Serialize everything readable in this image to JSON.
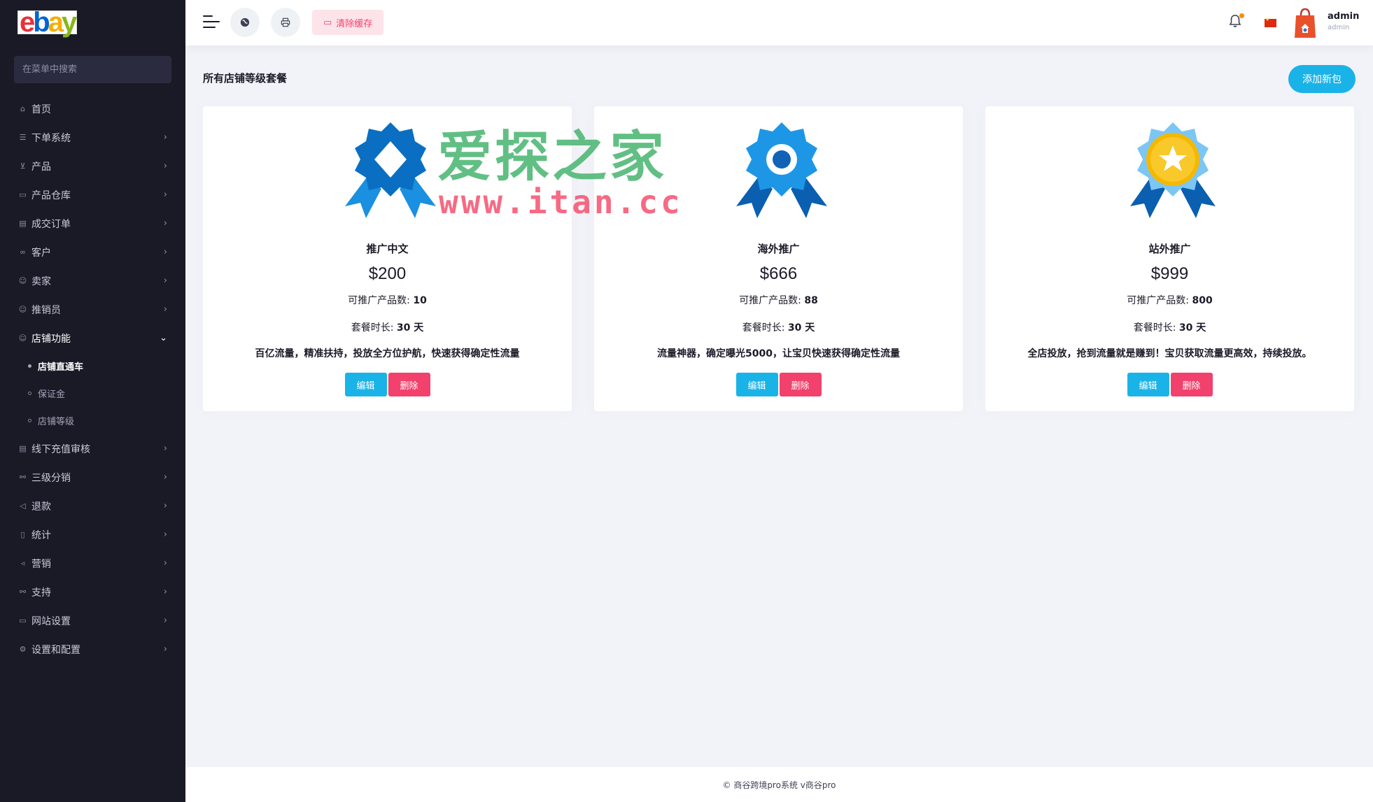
{
  "brand": {
    "logo_text": "ebay"
  },
  "sidebar": {
    "search_placeholder": "在菜单中搜索",
    "items": [
      {
        "label": "首页",
        "icon": "home-icon",
        "has_children": false
      },
      {
        "label": "下单系统",
        "icon": "list-icon",
        "has_children": true
      },
      {
        "label": "产品",
        "icon": "cart-icon",
        "has_children": true
      },
      {
        "label": "产品仓库",
        "icon": "archive-icon",
        "has_children": true
      },
      {
        "label": "成交订单",
        "icon": "money-icon",
        "has_children": true
      },
      {
        "label": "客户",
        "icon": "users-icon",
        "has_children": true
      },
      {
        "label": "卖家",
        "icon": "user-icon",
        "has_children": true
      },
      {
        "label": "推销员",
        "icon": "user-icon",
        "has_children": true
      },
      {
        "label": "店铺功能",
        "icon": "user-icon",
        "has_children": true,
        "open": true
      },
      {
        "label": "线下充值审核",
        "icon": "money-icon",
        "has_children": true
      },
      {
        "label": "三级分销",
        "icon": "link-icon",
        "has_children": true
      },
      {
        "label": "退款",
        "icon": "rewind-icon",
        "has_children": true
      },
      {
        "label": "统计",
        "icon": "file-icon",
        "has_children": true
      },
      {
        "label": "营销",
        "icon": "megaphone-icon",
        "has_children": true
      },
      {
        "label": "支持",
        "icon": "link-icon",
        "has_children": true
      },
      {
        "label": "网站设置",
        "icon": "monitor-icon",
        "has_children": true
      },
      {
        "label": "设置和配置",
        "icon": "gear-icon",
        "has_children": true
      }
    ],
    "submenu": [
      {
        "label": "店铺直通车",
        "active": true
      },
      {
        "label": "保证金",
        "active": false
      },
      {
        "label": "店铺等级",
        "active": false
      }
    ]
  },
  "header": {
    "clear_cache_label": "清除缓存",
    "user_name": "admin",
    "user_role": "admin",
    "language_flag": "cn-flag-icon"
  },
  "main": {
    "title": "所有店铺等级套餐",
    "add_button_label": "添加新包",
    "packages": [
      {
        "name": "推广中文",
        "price": "$200",
        "products_label": "可推广产品数:",
        "products_value": "10",
        "duration_label": "套餐时长:",
        "duration_value": "30 天",
        "description": "百亿流量，精准扶持，投放全方位护航，快速获得确定性流量",
        "edit_label": "编辑",
        "delete_label": "删除",
        "badge": "diamond-rosette-badge-icon"
      },
      {
        "name": "海外推广",
        "price": "$666",
        "products_label": "可推广产品数:",
        "products_value": "88",
        "duration_label": "套餐时长:",
        "duration_value": "30 天",
        "description": "流量神器，确定曝光5000，让宝贝快速获得确定性流量",
        "edit_label": "编辑",
        "delete_label": "删除",
        "badge": "circle-rosette-badge-icon"
      },
      {
        "name": "站外推广",
        "price": "$999",
        "products_label": "可推广产品数:",
        "products_value": "800",
        "duration_label": "套餐时长:",
        "duration_value": "30 天",
        "description": "全店投放，抢到流量就是赚到！宝贝获取流量更高效，持续投放。",
        "edit_label": "编辑",
        "delete_label": "删除",
        "badge": "star-rosette-badge-icon"
      }
    ]
  },
  "watermark": {
    "cn": "爱探之家",
    "url": "www.itan.cc"
  },
  "footer": {
    "text": "© 商谷跨境pro系统 v商谷pro"
  },
  "colors": {
    "sidebar_bg": "#1a1a27",
    "primary": "#1ab3e8",
    "danger": "#f1416c",
    "page_bg": "#f2f3f8"
  }
}
